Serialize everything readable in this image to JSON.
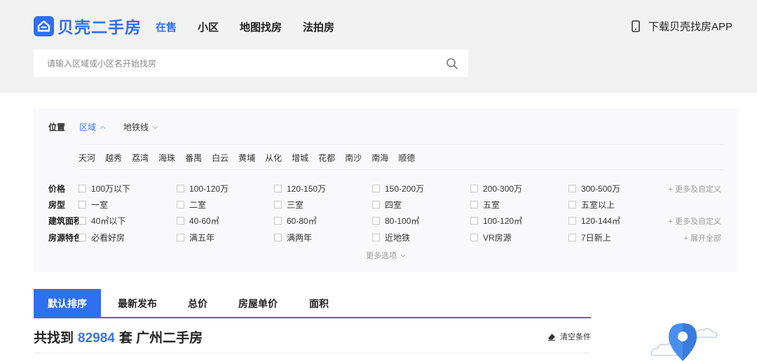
{
  "header": {
    "brand": "贝壳二手房",
    "nav": [
      "在售",
      "小区",
      "地图找房",
      "法拍房"
    ],
    "app_download": "下载贝壳找房APP",
    "search_placeholder": "请输入区域或小区名开始找房",
    "accent": "#2f6ff0"
  },
  "filters": {
    "location": {
      "label": "位置",
      "tabs": [
        "区域",
        "地铁线"
      ],
      "districts": [
        "天河",
        "越秀",
        "荔湾",
        "海珠",
        "番禺",
        "白云",
        "黄埔",
        "从化",
        "增城",
        "花都",
        "南沙",
        "南海",
        "顺德"
      ]
    },
    "price": {
      "label": "价格",
      "options": [
        "100万以下",
        "100-120万",
        "120-150万",
        "150-200万",
        "200-300万",
        "300-500万"
      ],
      "more": "+ 更多及自定义"
    },
    "layout": {
      "label": "房型",
      "options": [
        "一室",
        "二室",
        "三室",
        "四室",
        "五室",
        "五室以上"
      ]
    },
    "area": {
      "label": "建筑面积",
      "options": [
        "40㎡以下",
        "40-60㎡",
        "60-80㎡",
        "80-100㎡",
        "100-120㎡",
        "120-144㎡"
      ],
      "more": "+ 更多及自定义"
    },
    "features": {
      "label": "房源特色",
      "options": [
        "必看好房",
        "满五年",
        "满两年",
        "近地铁",
        "VR房源",
        "7日新上"
      ],
      "more": "+ 展开全部"
    },
    "more_options": "更多选项"
  },
  "sort": {
    "tabs": [
      "默认排序",
      "最新发布",
      "总价",
      "房屋单价",
      "面积"
    ],
    "active_index": 0
  },
  "results": {
    "prefix": "共找到",
    "count": "82984",
    "suffix": "套 广州二手房",
    "clear_label": "清空条件"
  }
}
